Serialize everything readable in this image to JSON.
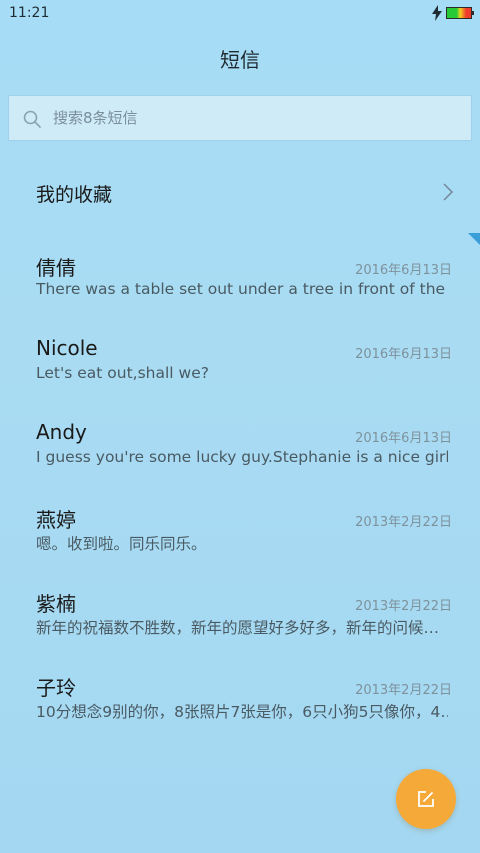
{
  "status_bar": {
    "time": "11:21",
    "charging_icon": "lightning-bolt-icon",
    "battery_icon": "battery-icon"
  },
  "header": {
    "title": "短信"
  },
  "search": {
    "placeholder": "搜索8条短信",
    "value": "",
    "icon": "search-icon"
  },
  "favorites": {
    "label": "我的收藏",
    "icon": "chevron-right-icon"
  },
  "conversations": [
    {
      "name": "倩倩",
      "date": "2016年6月13日",
      "preview": "There was a table set out under a tree in front of the ho.."
    },
    {
      "name": "Nicole",
      "date": "2016年6月13日",
      "preview": "Let's eat out,shall we?"
    },
    {
      "name": "Andy",
      "date": "2016年6月13日",
      "preview": "I guess you're some lucky guy.Stephanie is a nice girl."
    },
    {
      "name": "燕婷",
      "date": "2013年2月22日",
      "preview": "嗯。收到啦。同乐同乐。"
    },
    {
      "name": "紫楠",
      "date": "2013年2月22日",
      "preview": "新年的祝福数不胜数，新年的愿望好多好多，新年的问候…"
    },
    {
      "name": "子玲",
      "date": "2013年2月22日",
      "preview": "10分想念9别的你，8张照片7张是你，6只小狗5只像你，4…"
    }
  ],
  "compose": {
    "icon": "compose-icon"
  },
  "colors": {
    "background": "#a6dcf5",
    "compose_button": "#f5a939",
    "date_text": "#7e929c"
  }
}
